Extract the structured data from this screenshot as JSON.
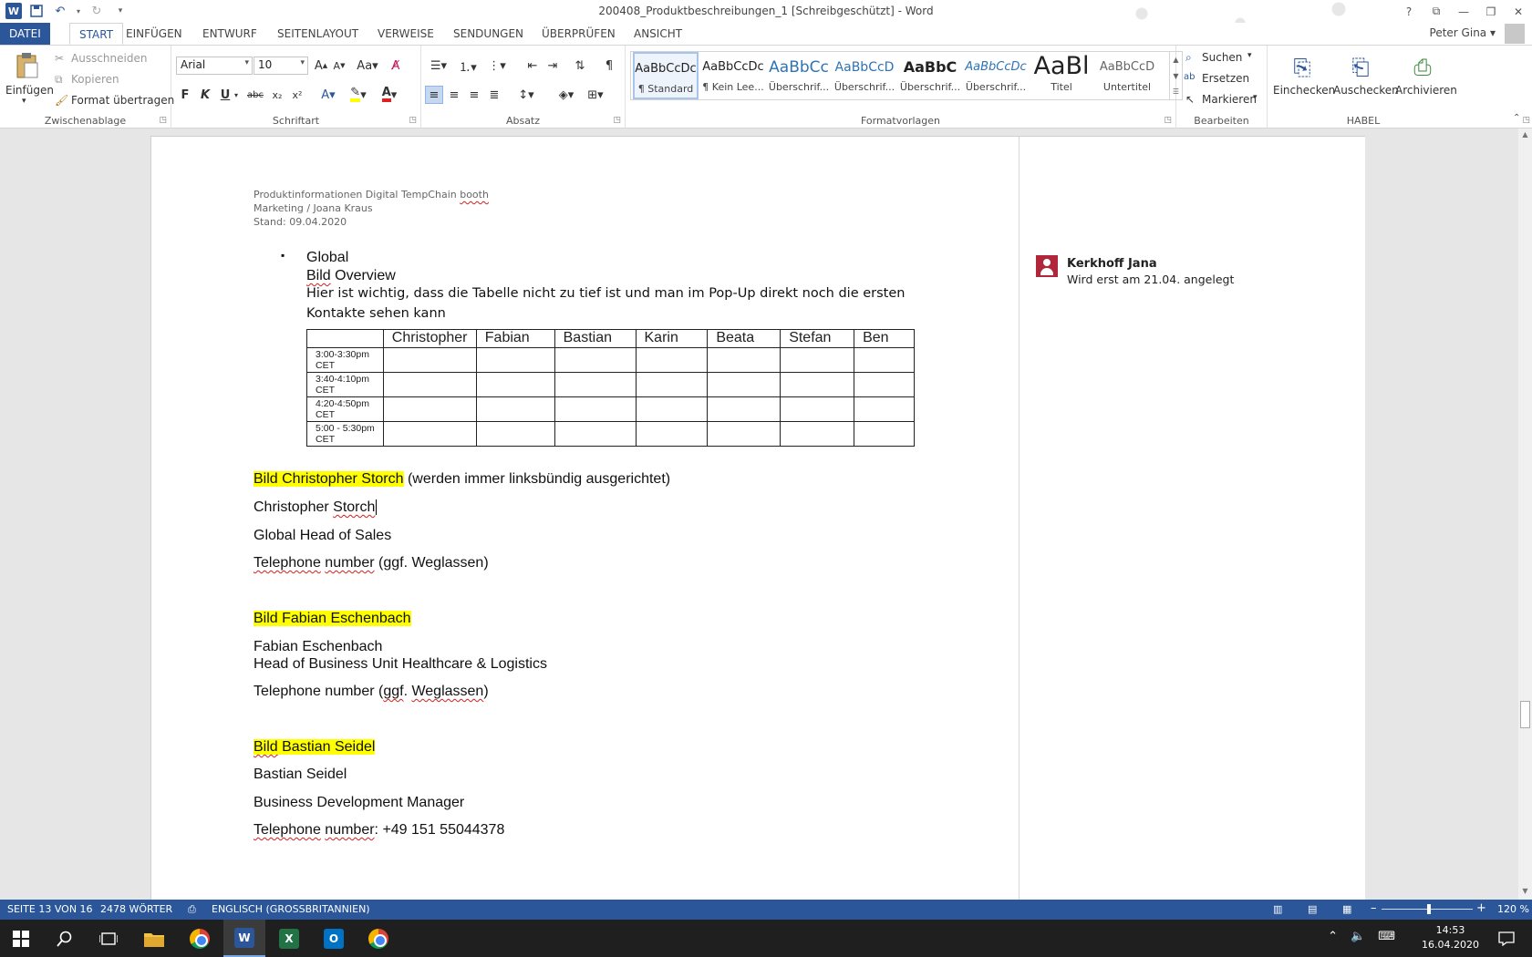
{
  "window": {
    "title": "200408_Produktbeschreibungen_1 [Schreibgeschützt] - Word",
    "help": "?",
    "ribbon_options": "⧉",
    "minimize": "—",
    "restore": "❐",
    "close": "✕",
    "qat_customize": "▾"
  },
  "tabs": {
    "datei": "DATEI",
    "start": "START",
    "einfuegen": "EINFÜGEN",
    "entwurf": "ENTWURF",
    "seitenlayout": "SEITENLAYOUT",
    "verweise": "VERWEISE",
    "sendungen": "SENDUNGEN",
    "ueberpruefen": "ÜBERPRÜFEN",
    "ansicht": "ANSICHT"
  },
  "user": {
    "name": "Peter Gina ▾"
  },
  "clipboard": {
    "paste": "Einfügen",
    "cut": "Ausschneiden",
    "copy": "Kopieren",
    "format_painter": "Format übertragen",
    "label": "Zwischenablage"
  },
  "font": {
    "family": "Arial",
    "size": "10",
    "bold": "F",
    "italic": "K",
    "underline": "U",
    "strike": "abc",
    "subscript": "x₂",
    "superscript": "x²",
    "label": "Schriftart"
  },
  "paragraph": {
    "label": "Absatz"
  },
  "styles": {
    "label": "Formatvorlagen",
    "items": [
      {
        "preview": "AaBbCcDc",
        "name": "¶ Standard"
      },
      {
        "preview": "AaBbCcDc",
        "name": "¶ Kein Lee..."
      },
      {
        "preview": "AaBbCc",
        "name": "Überschrif..."
      },
      {
        "preview": "AaBbCcD",
        "name": "Überschrif..."
      },
      {
        "preview": "AaBbC",
        "name": "Überschrif..."
      },
      {
        "preview": "AaBbCcDc",
        "name": "Überschrif..."
      },
      {
        "preview": "AaBl",
        "name": "Titel"
      },
      {
        "preview": "AaBbCcD",
        "name": "Untertitel"
      }
    ]
  },
  "editing": {
    "find": "Suchen",
    "replace": "Ersetzen",
    "select": "Markieren",
    "label": "Bearbeiten"
  },
  "habel": {
    "checkin": "Einchecken",
    "checkout": "Auschecken",
    "archive": "Archivieren",
    "label": "HABEL"
  },
  "document": {
    "header": {
      "line1": "Produktinformationen Digital TempChain",
      "line1_sq": "booth",
      "line2": "Marketing / Joana Kraus",
      "line3": "Stand: 09.04.2020"
    },
    "bullet": "▪",
    "bullet_text": "Global",
    "bild_word": "Bild",
    "bild_rest": " Overview",
    "note_line1": "Hier ist wichtig, dass die Tabelle nicht zu tief ist und man im Pop-Up direkt noch die ersten",
    "note_line2": "Kontakte sehen kann",
    "table": {
      "headers": [
        "",
        "Christopher",
        "Fabian",
        "Bastian",
        "Karin",
        "Beata",
        "Stefan",
        "Ben"
      ],
      "rows": [
        "3:00-3:30pm CET",
        "3:40-4:10pm CET",
        "4:20-4:50pm CET",
        "5:00 - 5:30pm CET"
      ]
    },
    "p1_hl": "Bild Christopher Storch",
    "p1_rest": " (werden immer linksbündig ausgerichtet)",
    "p2_a": "Christopher ",
    "p2_sq": "Storch",
    "p3": "Global Head of Sales",
    "p4_sq1": "Telephone",
    "p4_sq2": "number",
    "p4_rest": " (ggf. Weglassen)",
    "p5_hl": "Bild Fabian Eschenbach",
    "p6": "Fabian Eschenbach",
    "p7": "Head of Business Unit Healthcare & Logistics",
    "p8_a": "Telephone number (",
    "p8_sq1": "ggf",
    "p8_b": ". ",
    "p8_sq2": "Weglassen",
    "p8_c": ")",
    "p9_hl_sq": "Bild",
    "p9_hl_rest": " Bastian Seidel",
    "p10": "Bastian Seidel",
    "p11": "Business Development Manager",
    "p12_sq1": "Telephone",
    "p12_sq2": "number",
    "p12_rest": ": +49 151 55044378"
  },
  "comment": {
    "author": "Kerkhoff Jana",
    "text": "Wird erst am 21.04. angelegt"
  },
  "status": {
    "page": "SEITE 13 VON 16",
    "words": "2478 WÖRTER",
    "language": "ENGLISCH (GROSSBRITANNIEN)",
    "zoom": "120 %",
    "zoom_minus": "–",
    "zoom_plus": "+",
    "zoom_level_percent": 120
  },
  "taskbar": {
    "time": "14:53",
    "date": "16.04.2020",
    "word_letter": "W",
    "excel_letter": "X",
    "outlook_letter": "O"
  },
  "colors": {
    "accent": "#2b579a",
    "highlight": "#ffff00",
    "spellcheck": "#d02020"
  }
}
